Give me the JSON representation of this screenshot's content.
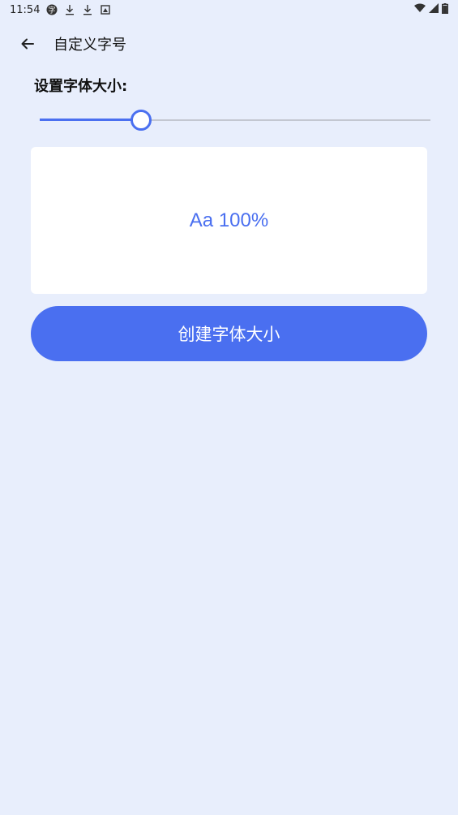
{
  "status_bar": {
    "time": "11:54",
    "icons": [
      "app-badge-icon",
      "download-icon",
      "download-icon",
      "screenshot-icon"
    ],
    "right_icons": [
      "wifi-icon",
      "signal-icon",
      "battery-icon"
    ]
  },
  "header": {
    "title": "自定义字号",
    "back_icon": "arrow-left-icon"
  },
  "font_size": {
    "label": "设置字体大小:",
    "slider_value": 0.26,
    "preview_text": "Aa 100%"
  },
  "actions": {
    "create_label": "创建字体大小"
  },
  "colors": {
    "accent": "#4a6ff0",
    "background": "#e8eefc",
    "card": "#ffffff"
  }
}
